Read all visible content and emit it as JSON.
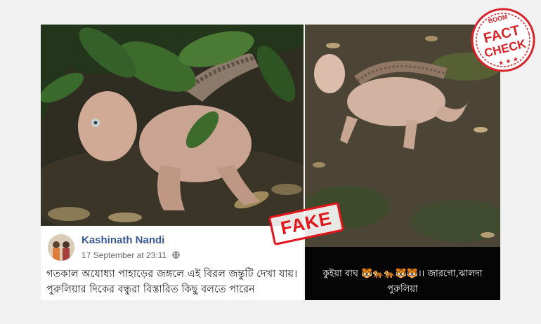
{
  "post": {
    "author": "Kashinath Nandi",
    "timestamp": "17 September at 23:11",
    "privacy_icon": "globe-icon",
    "caption_line1": "গতকাল অযোধ্যা পাহাড়ের জঙ্গলে এই বিরল জন্তুটি দেখা যায়।",
    "caption_line2": "পুরুলিয়ার দিকের বন্ধুরা বিস্তারিত কিছু বলতে পারেন"
  },
  "right_panel": {
    "caption_line1": "কুইয়া বাঘ 🐯🐅🐅🐯🐯।। জারগো,ঝালদা",
    "caption_line2": "পুরুলিয়া"
  },
  "stamp": {
    "label": "FAKE",
    "color": "#e4141b"
  },
  "seal": {
    "brand": "BOOM",
    "line1": "FACT",
    "line2": "CHECK",
    "color": "#d9232a"
  }
}
